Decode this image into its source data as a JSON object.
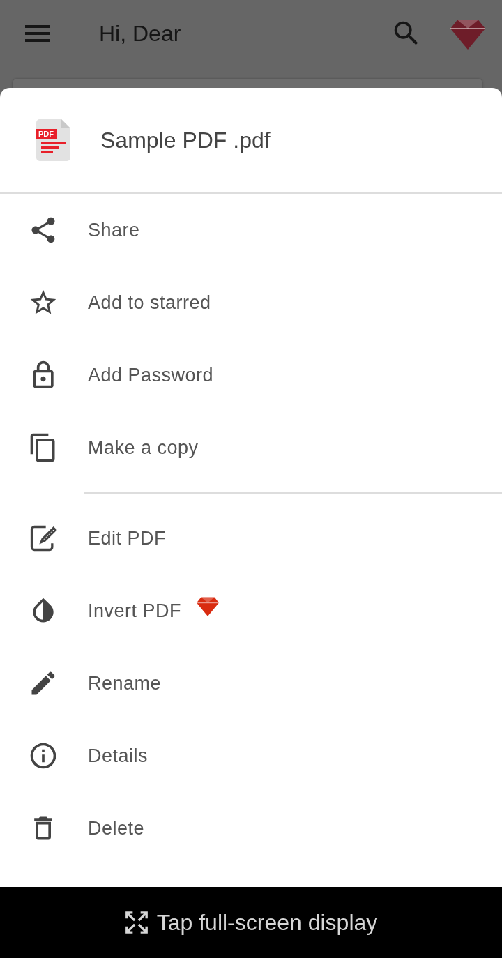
{
  "app_bar": {
    "title": "Hi, Dear"
  },
  "sheet": {
    "file_name": "Sample PDF .pdf",
    "file_badge": "PDF",
    "sections": [
      {
        "items": [
          {
            "kind": "share",
            "label": "Share",
            "premium": false
          },
          {
            "kind": "star",
            "label": "Add to starred",
            "premium": false
          },
          {
            "kind": "lock",
            "label": "Add Password",
            "premium": false
          },
          {
            "kind": "copy",
            "label": "Make a copy",
            "premium": false
          }
        ]
      },
      {
        "items": [
          {
            "kind": "edit",
            "label": "Edit PDF",
            "premium": false
          },
          {
            "kind": "invert",
            "label": "Invert PDF",
            "premium": true
          },
          {
            "kind": "rename",
            "label": "Rename",
            "premium": false
          },
          {
            "kind": "details",
            "label": "Details",
            "premium": false
          },
          {
            "kind": "delete",
            "label": "Delete",
            "premium": false
          }
        ]
      }
    ]
  },
  "banner": {
    "label": "Tap full-screen display"
  }
}
